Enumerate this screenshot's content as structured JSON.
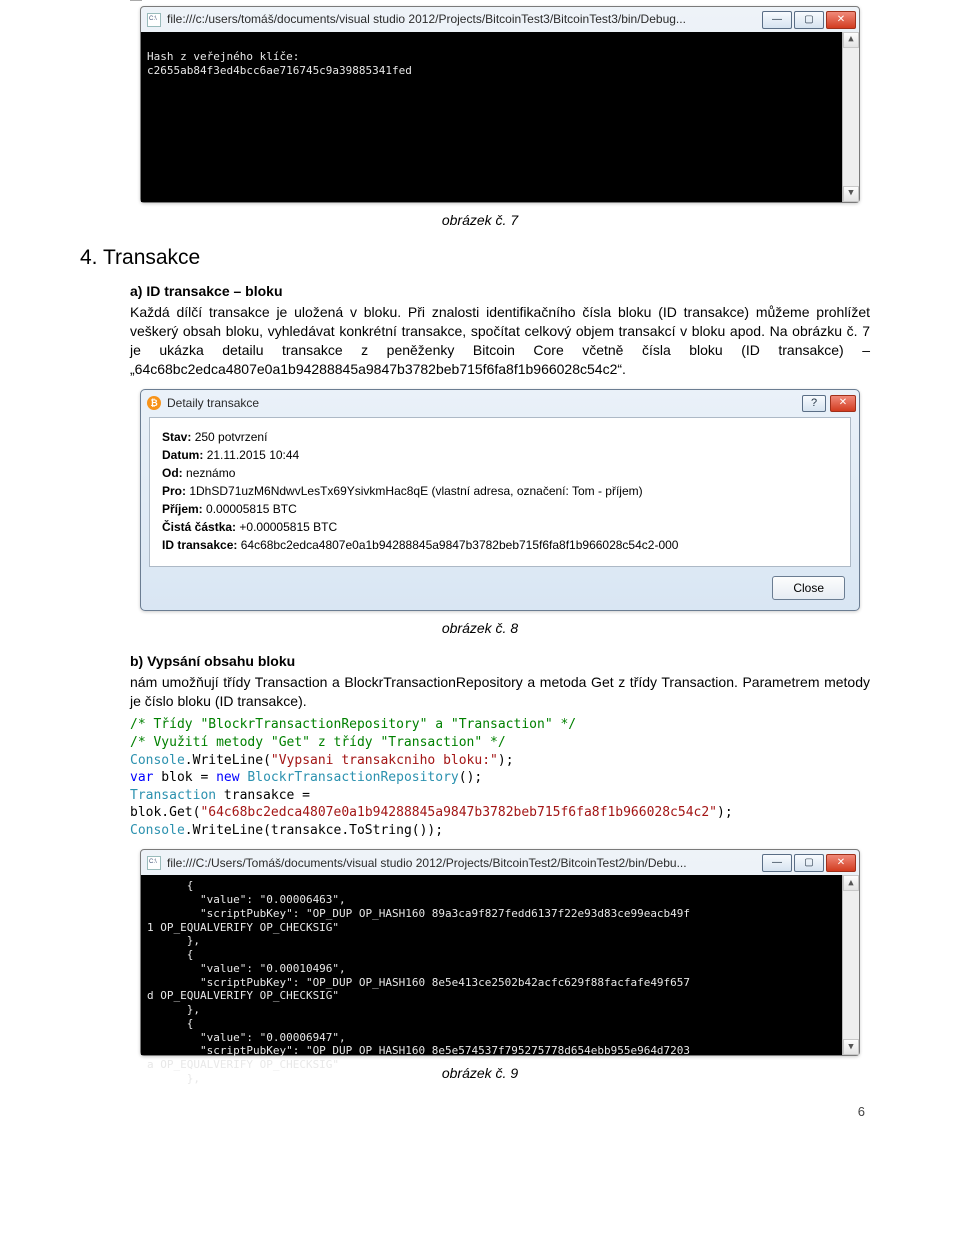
{
  "console1": {
    "title": "file:///c:/users/tomáš/documents/visual studio 2012/Projects/BitcoinTest3/BitcoinTest3/bin/Debug...",
    "line1": "Hash z veřejného klíče:",
    "line2": "c2655ab84f3ed4bcc6ae716745c9a39885341fed"
  },
  "caption1": "obrázek č. 7",
  "sectionTitle": "4. Transakce",
  "subA": {
    "heading": "a) ID transakce – bloku",
    "p": "Každá dílčí transakce je uložená v bloku. Při znalosti identifikačního čísla bloku (ID transakce) můžeme prohlížet veškerý obsah bloku, vyhledávat konkrétní transakce, spočítat celkový objem transakcí v bloku apod. Na obrázku č. 7 je ukázka detailu transakce z peněženky Bitcoin Core včetně čísla bloku (ID transakce) – „64c68bc2edca4807e0a1b94288845a9847b3782beb715f6fa8f1b966028c54c2“."
  },
  "dlg": {
    "title": "Detaily transakce",
    "rows": {
      "stav": {
        "k": "Stav:",
        "v": "250 potvrzení"
      },
      "datum": {
        "k": "Datum:",
        "v": "21.11.2015 10:44"
      },
      "od": {
        "k": "Od:",
        "v": "neznámo"
      },
      "pro": {
        "k": "Pro:",
        "v": "1DhSD71uzM6NdwvLesTx69YsivkmHac8qE (vlastní adresa, označení: Tom - příjem)"
      },
      "prijem": {
        "k": "Příjem:",
        "v": "0.00005815 BTC"
      },
      "cista": {
        "k": "Čistá částka:",
        "v": "+0.00005815 BTC"
      },
      "idtx": {
        "k": "ID transakce:",
        "v": "64c68bc2edca4807e0a1b94288845a9847b3782beb715f6fa8f1b966028c54c2-000"
      }
    },
    "close": "Close"
  },
  "caption2": "obrázek č. 8",
  "subB": {
    "heading": "b) Vypsání obsahu bloku",
    "p": "nám umožňují třídy Transaction a BlockrTransactionRepository a metoda Get z třídy Transaction. Parametrem metody je číslo bloku (ID transakce)."
  },
  "code": {
    "c1": "/* Třídy \"BlockrTransactionRepository\" a \"Transaction\" */",
    "c2": "/* Využití metody \"Get\" z třídy \"Transaction\" */",
    "l3a": "Console",
    "l3b": ".WriteLine(",
    "l3c": "\"Vypsani transakcniho bloku:\"",
    "l3d": ");",
    "l4a": "var",
    "l4b": " blok = ",
    "l4c": "new",
    "l4d": " ",
    "l4e": "BlockrTransactionRepository",
    "l4f": "();",
    "l5a": "Transaction",
    "l5b": " transakce =",
    "l6a": "blok.Get(",
    "l6b": "\"64c68bc2edca4807e0a1b94288845a9847b3782beb715f6fa8f1b966028c54c2\"",
    "l6c": ");",
    "l7a": "Console",
    "l7b": ".WriteLine(transakce.ToString());"
  },
  "console2": {
    "title": "file:///C:/Users/Tomáš/documents/visual studio 2012/Projects/BitcoinTest2/BitcoinTest2/bin/Debu...",
    "body": "      {\n        \"value\": \"0.00006463\",\n        \"scriptPubKey\": \"OP_DUP OP_HASH160 89a3ca9f827fedd6137f22e93d83ce99eacb49f\n1 OP_EQUALVERIFY OP_CHECKSIG\"\n      },\n      {\n        \"value\": \"0.00010496\",\n        \"scriptPubKey\": \"OP_DUP OP_HASH160 8e5e413ce2502b42acfc629f88facfafe49f657\nd OP_EQUALVERIFY OP_CHECKSIG\"\n      },\n      {\n        \"value\": \"0.00006947\",\n        \"scriptPubKey\": \"OP_DUP OP_HASH160 8e5e574537f795275778d654ebb955e964d7203\na OP_EQUALVERIFY OP_CHECKSIG\"\n      },"
  },
  "caption3": "obrázek č. 9",
  "pageNum": "6",
  "glyph": {
    "min": "—",
    "max": "▢",
    "x": "✕",
    "up": "▲",
    "down": "▼",
    "help": "?",
    "bc": "₿"
  }
}
